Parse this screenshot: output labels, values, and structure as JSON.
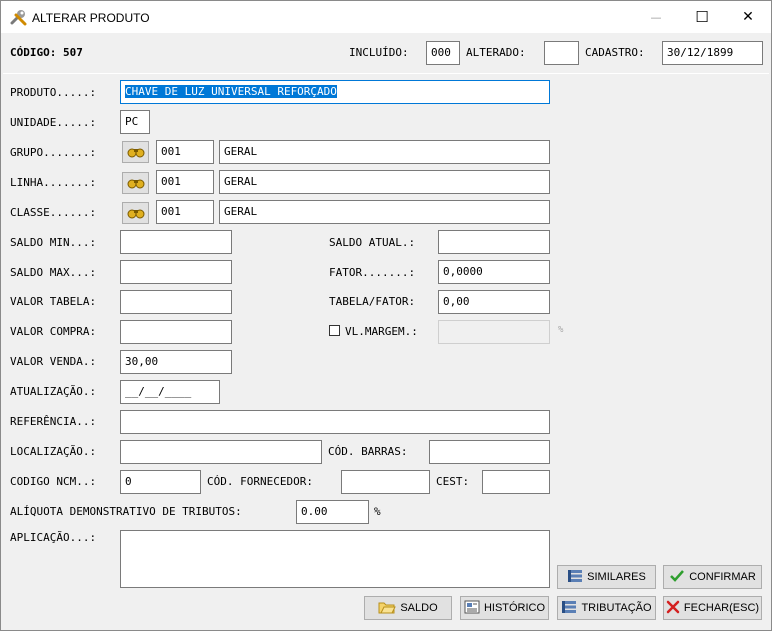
{
  "window": {
    "title": "ALTERAR PRODUTO",
    "minimize": "—",
    "maximize": "☐",
    "close": "✕"
  },
  "header": {
    "codigo_label": "CÓDIGO: 507",
    "incluido_label": "INCLUÍDO:",
    "incluido_value": "000",
    "alterado_label": "ALTERADO:",
    "alterado_value": "",
    "cadastro_label": "CADASTRO:",
    "cadastro_value": "30/12/1899"
  },
  "form": {
    "produto_label": "PRODUTO.....:",
    "produto_value": "CHAVE DE LUZ UNIVERSAL REFORÇADO",
    "unidade_label": "UNIDADE.....:",
    "unidade_value": "PC",
    "grupo_label": "GRUPO.......:",
    "grupo_code": "001",
    "grupo_name": "GERAL",
    "linha_label": "LINHA.......:",
    "linha_code": "001",
    "linha_name": "GERAL",
    "classe_label": "CLASSE......:",
    "classe_code": "001",
    "classe_name": "GERAL",
    "saldo_min_label": "SALDO MIN...:",
    "saldo_min_value": "",
    "saldo_atual_label": "SALDO ATUAL.:",
    "saldo_atual_value": "",
    "saldo_max_label": "SALDO MAX...:",
    "saldo_max_value": "",
    "fator_label": "FATOR.......:",
    "fator_value": "0,0000",
    "valor_tabela_label": "VALOR TABELA:",
    "valor_tabela_value": "",
    "tabela_fator_label": "TABELA/FATOR:",
    "tabela_fator_value": "0,00",
    "valor_compra_label": "VALOR COMPRA:",
    "valor_compra_value": "",
    "vl_margem_label": "VL.MARGEM.:",
    "vl_margem_value": "",
    "percent_symbol": "%",
    "valor_venda_label": "VALOR VENDA.:",
    "valor_venda_value": "30,00",
    "atualizacao_label": "ATUALIZAÇÃO.:",
    "atualizacao_value": "__/__/____",
    "referencia_label": "REFERÊNCIA..:",
    "referencia_value": "",
    "localizacao_label": "LOCALIZAÇÃO.:",
    "localizacao_value": "",
    "cod_barras_label": "CÓD. BARRAS:",
    "cod_barras_value": "",
    "codigo_ncm_label": "CODIGO NCM..:",
    "codigo_ncm_value": "0",
    "cod_fornecedor_label": "CÓD. FORNECEDOR:",
    "cod_fornecedor_value": "",
    "cest_label": "CEST:",
    "cest_value": "",
    "aliquota_label": "ALÍQUOTA DEMONSTRATIVO DE TRIBUTOS:",
    "aliquota_value": "0.00",
    "aliquota_percent": "%",
    "aplicacao_label": "APLICAÇÃO...:",
    "aplicacao_value": ""
  },
  "buttons": {
    "similares": "SIMILARES",
    "confirmar": "CONFIRMAR",
    "saldo": "SALDO",
    "historico": "HISTÓRICO",
    "tributacao": "TRIBUTAÇÃO",
    "fechar": "FECHAR(ESC)"
  },
  "colors": {
    "selection": "#0078d7",
    "confirm_check": "#2e9e2e",
    "close_x": "#d42020",
    "title_icon": "#d08a00"
  }
}
